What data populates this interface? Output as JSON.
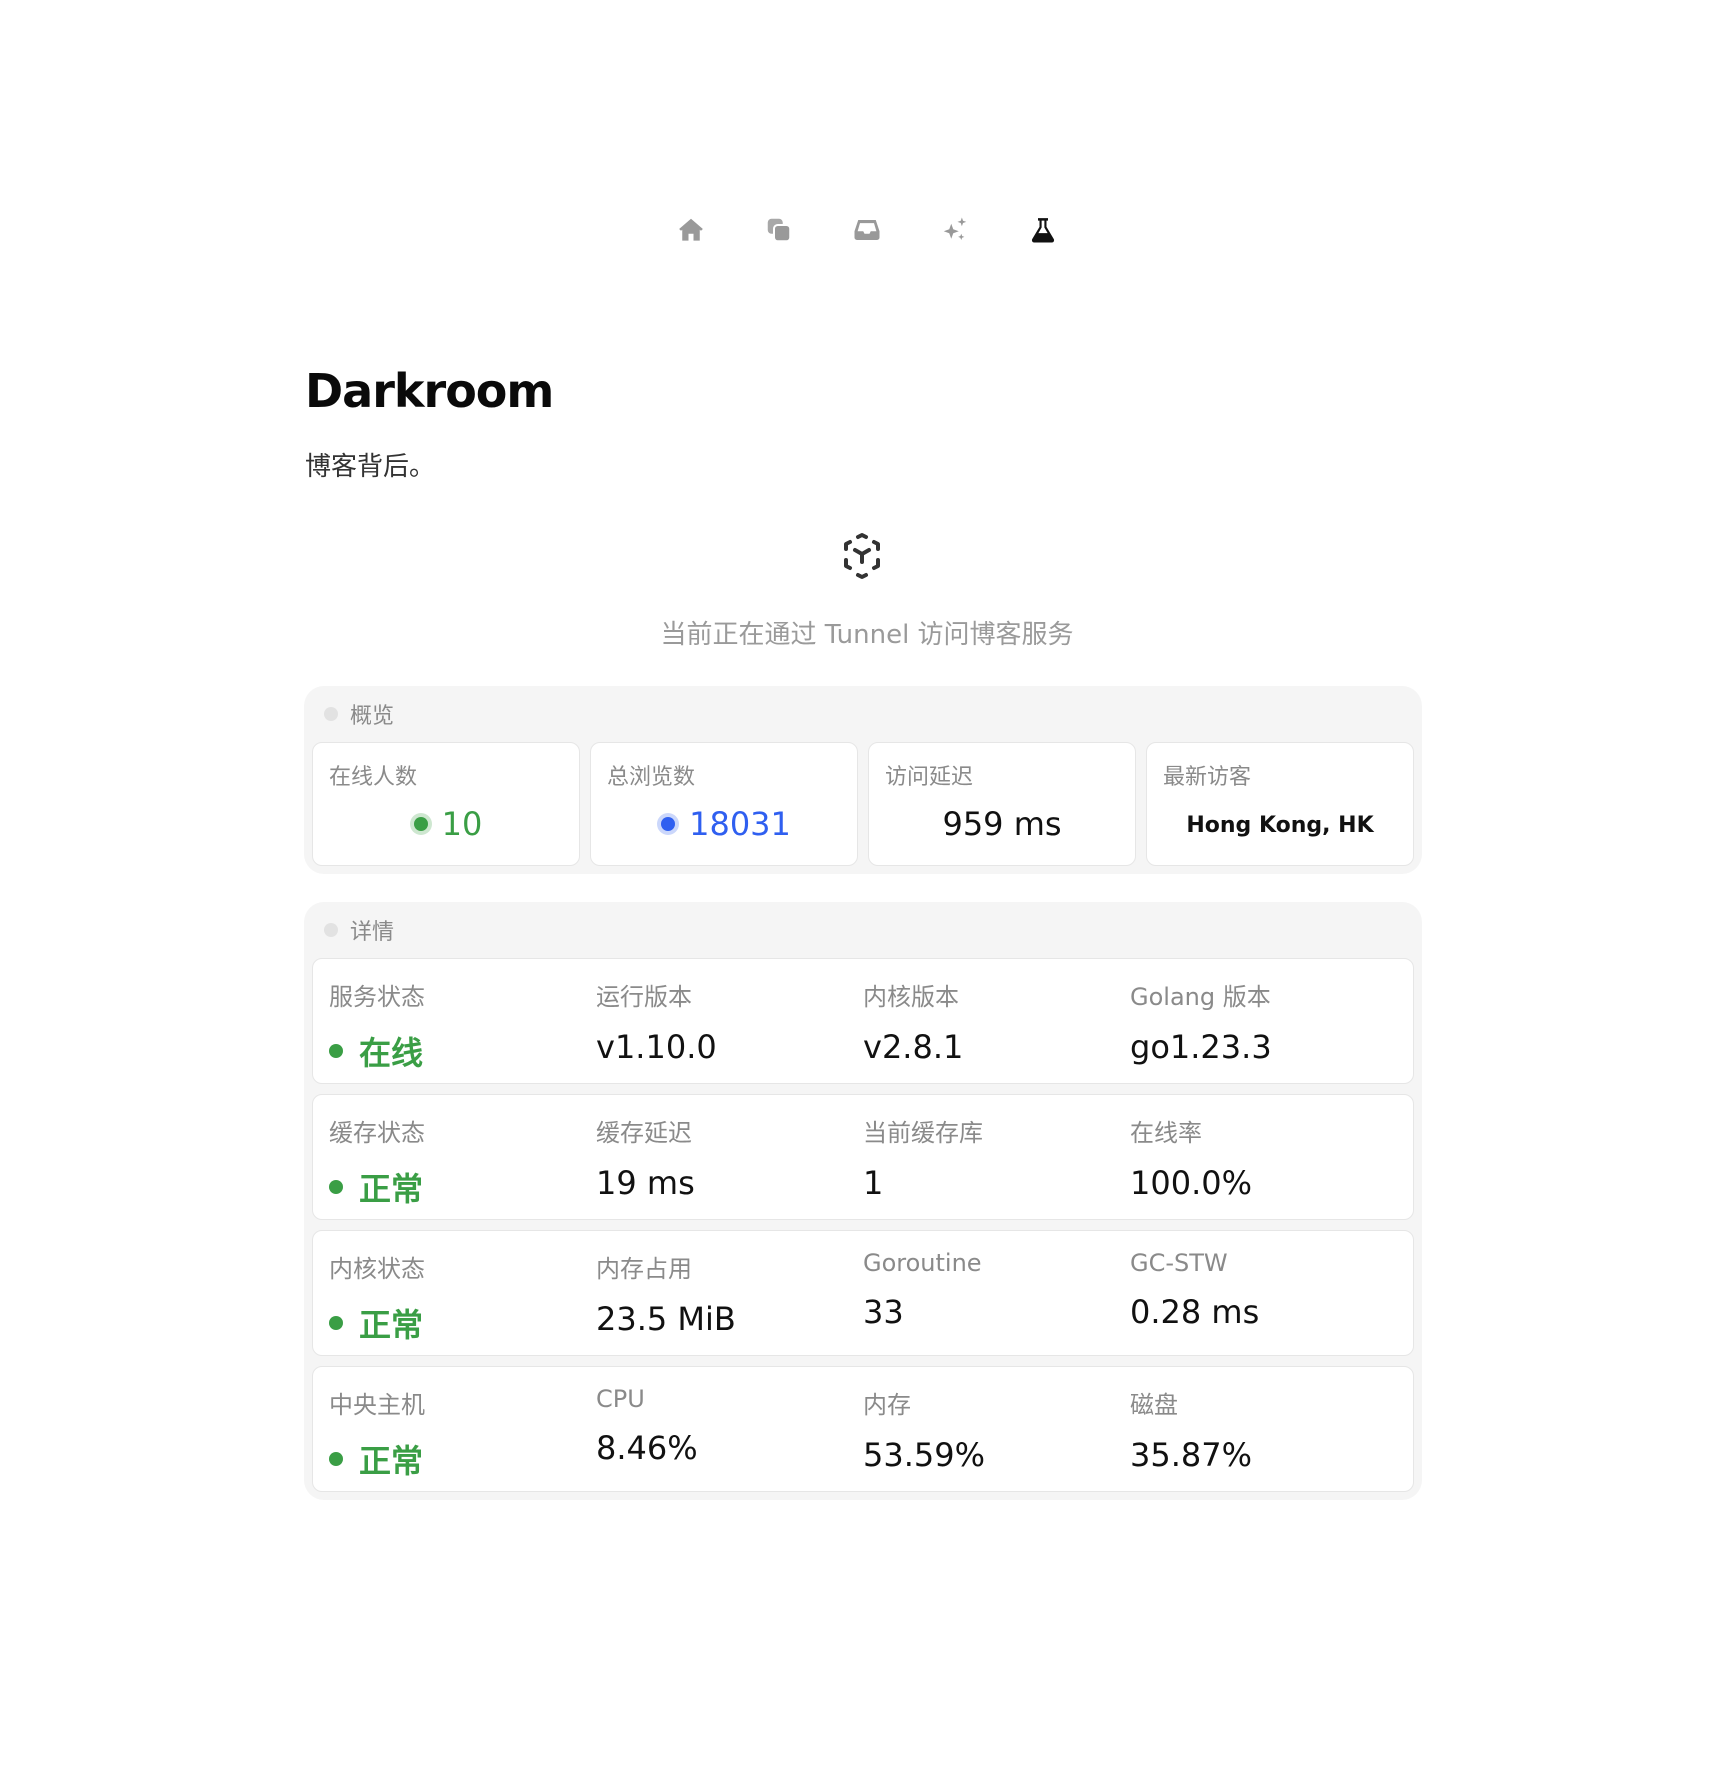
{
  "nav": {
    "items": [
      {
        "icon": "home-icon"
      },
      {
        "icon": "copy-icon"
      },
      {
        "icon": "inbox-icon"
      },
      {
        "icon": "sparkles-icon"
      },
      {
        "icon": "flask-icon",
        "active": true
      }
    ]
  },
  "page": {
    "title": "Darkroom",
    "subtitle": "博客背后。"
  },
  "tunnel": {
    "icon": "tunnel-icon",
    "text": "当前正在通过 Tunnel 访问博客服务"
  },
  "colors": {
    "green": "#3a9e45",
    "blue": "#2f5ff0",
    "muted": "#8a8a8a"
  },
  "overview": {
    "label": "概览",
    "cards": [
      {
        "label": "在线人数",
        "value": "10",
        "color": "#3a9e45"
      },
      {
        "label": "总浏览数",
        "value": "18031",
        "color": "#2f5ff0"
      },
      {
        "label": "访问延迟",
        "value": "959 ms"
      },
      {
        "label": "最新访客",
        "value": "Hong Kong, HK"
      }
    ]
  },
  "details": {
    "label": "详情",
    "rows": [
      {
        "status_label": "服务状态",
        "status_value": "在线",
        "c1_label": "运行版本",
        "c1_value": "v1.10.0",
        "c2_label": "内核版本",
        "c2_value": "v2.8.1",
        "c3_label": "Golang 版本",
        "c3_value": "go1.23.3"
      },
      {
        "status_label": "缓存状态",
        "status_value": "正常",
        "c1_label": "缓存延迟",
        "c1_value": "19 ms",
        "c2_label": "当前缓存库",
        "c2_value": "1",
        "c3_label": "在线率",
        "c3_value": "100.0%"
      },
      {
        "status_label": "内核状态",
        "status_value": "正常",
        "c1_label": "内存占用",
        "c1_value": "23.5 MiB",
        "c2_label": "Goroutine",
        "c2_value": "33",
        "c3_label": "GC-STW",
        "c3_value": "0.28 ms"
      },
      {
        "status_label": "中央主机",
        "status_value": "正常",
        "c1_label": "CPU",
        "c1_value": "8.46%",
        "c2_label": "内存",
        "c2_value": "53.59%",
        "c3_label": "磁盘",
        "c3_value": "35.87%"
      }
    ]
  }
}
